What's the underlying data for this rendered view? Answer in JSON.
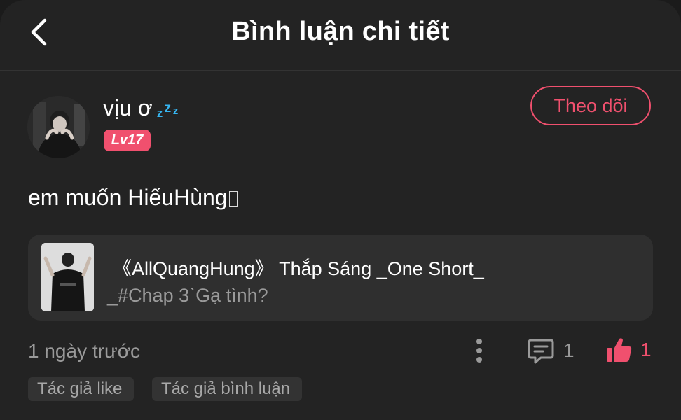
{
  "header": {
    "title": "Bình luận chi tiết",
    "back_icon": "chevron-left-icon"
  },
  "user": {
    "name": "vịu ơ",
    "name_suffix_emoji": "zzz-emoji",
    "level": "Lv17",
    "follow_label": "Theo dõi"
  },
  "comment": {
    "text": "em muốn HiếuHùng",
    "trailing_emoji": "missing-glyph"
  },
  "story": {
    "title": "《AllQuangHung》 Thắp Sáng _One Short_",
    "chapter": "_#Chap 3`Gạ tình?"
  },
  "meta": {
    "time_ago": "1 ngày trước",
    "reply_count": "1",
    "like_count": "1"
  },
  "tags": [
    {
      "label": "Tác giả like"
    },
    {
      "label": "Tác giả bình luận"
    }
  ],
  "colors": {
    "accent": "#f0506e",
    "background": "#232323",
    "card": "#2f2f2f",
    "muted_text": "#9a9a9a",
    "zzz": "#36b5f0"
  }
}
